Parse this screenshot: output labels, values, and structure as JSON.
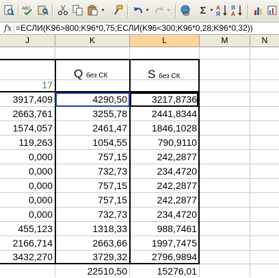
{
  "toolbar": {
    "icons": [
      "print-preview-icon",
      "spelling-icon",
      "research-icon",
      "cut-icon",
      "copy-icon",
      "paste-icon",
      "format-painter-icon",
      "undo-icon",
      "redo-icon",
      "hyperlink-icon",
      "autosum-icon",
      "sort-ascending-icon",
      "sort-descending-icon",
      "chart-wizard-icon"
    ]
  },
  "formula_bar": {
    "fx": "fx",
    "formula": "=ЕСЛИ(K96>800;K96*0,75;ЕСЛИ(K96<300;K96*0,28;K96*0,32))"
  },
  "columns": [
    "J",
    "K",
    "L",
    "M",
    "N"
  ],
  "headers": {
    "q_main": "Q",
    "q_sub": "без СК",
    "s_main": "S",
    "s_sub": "без СК",
    "j_value": "17"
  },
  "rows": [
    {
      "j": "3917,409",
      "k": "4290,50",
      "l": "3217,8736"
    },
    {
      "j": "2663,761",
      "k": "3255,78",
      "l": "2441,8344"
    },
    {
      "j": "1574,057",
      "k": "2461,47",
      "l": "1846,1028"
    },
    {
      "j": "119,263",
      "k": "1054,55",
      "l": "790,9110"
    },
    {
      "j": "0,000",
      "k": "757,15",
      "l": "242,2877"
    },
    {
      "j": "0,000",
      "k": "732,73",
      "l": "234,4720"
    },
    {
      "j": "0,000",
      "k": "757,15",
      "l": "242,2877"
    },
    {
      "j": "0,000",
      "k": "757,15",
      "l": "242,2877"
    },
    {
      "j": "0,000",
      "k": "732,73",
      "l": "234,4720"
    },
    {
      "j": "455,123",
      "k": "1318,33",
      "l": "988,7461"
    },
    {
      "j": "2166,714",
      "k": "2663,66",
      "l": "1997,7475"
    },
    {
      "j": "3432,270",
      "k": "3729,32",
      "l": "2796,9894"
    }
  ],
  "totals": {
    "k": "22510,50",
    "l": "15276,01"
  },
  "colors": {
    "selected_header": "#ffd59a",
    "selection_border": "#1f3fa6",
    "green_value": "#3c8c3c"
  }
}
